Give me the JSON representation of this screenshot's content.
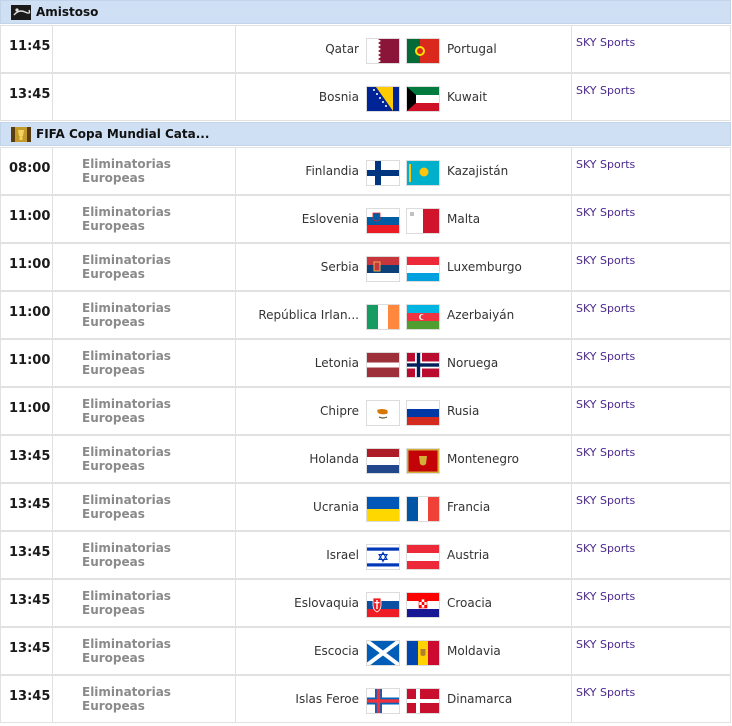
{
  "colors": {
    "group_header_bg": "#cfe0f4",
    "row_border": "#e1e1e1",
    "time_text": "#1a1a1a",
    "competition_text": "#8a8a8a",
    "channel_text": "#4b2a8c"
  },
  "groups": [
    {
      "title": "Amistoso",
      "icon": "friendly-match-icon",
      "matches": [
        {
          "time": "11:45",
          "competition": "",
          "home": "Qatar",
          "home_flag": "qatar-flag-icon",
          "away": "Portugal",
          "away_flag": "portugal-flag-icon",
          "channel": "SKY Sports"
        },
        {
          "time": "13:45",
          "competition": "",
          "home": "Bosnia",
          "home_flag": "bosnia-flag-icon",
          "away": "Kuwait",
          "away_flag": "kuwait-flag-icon",
          "channel": "SKY Sports"
        }
      ]
    },
    {
      "title": "FIFA Copa Mundial Cata...",
      "icon": "world-cup-icon",
      "matches": [
        {
          "time": "08:00",
          "competition": "Eliminatorias Europeas",
          "home": "Finlandia",
          "home_flag": "finland-flag-icon",
          "away": "Kazajistán",
          "away_flag": "kazakhstan-flag-icon",
          "channel": "SKY Sports"
        },
        {
          "time": "11:00",
          "competition": "Eliminatorias Europeas",
          "home": "Eslovenia",
          "home_flag": "slovenia-flag-icon",
          "away": "Malta",
          "away_flag": "malta-flag-icon",
          "channel": "SKY Sports"
        },
        {
          "time": "11:00",
          "competition": "Eliminatorias Europeas",
          "home": "Serbia",
          "home_flag": "serbia-flag-icon",
          "away": "Luxemburgo",
          "away_flag": "luxembourg-flag-icon",
          "channel": "SKY Sports"
        },
        {
          "time": "11:00",
          "competition": "Eliminatorias Europeas",
          "home": "República Irlan...",
          "home_flag": "ireland-flag-icon",
          "away": "Azerbaiyán",
          "away_flag": "azerbaijan-flag-icon",
          "channel": "SKY Sports"
        },
        {
          "time": "11:00",
          "competition": "Eliminatorias Europeas",
          "home": "Letonia",
          "home_flag": "latvia-flag-icon",
          "away": "Noruega",
          "away_flag": "norway-flag-icon",
          "channel": "SKY Sports"
        },
        {
          "time": "11:00",
          "competition": "Eliminatorias Europeas",
          "home": "Chipre",
          "home_flag": "cyprus-flag-icon",
          "away": "Rusia",
          "away_flag": "russia-flag-icon",
          "channel": "SKY Sports"
        },
        {
          "time": "13:45",
          "competition": "Eliminatorias Europeas",
          "home": "Holanda",
          "home_flag": "netherlands-flag-icon",
          "away": "Montenegro",
          "away_flag": "montenegro-flag-icon",
          "channel": "SKY Sports"
        },
        {
          "time": "13:45",
          "competition": "Eliminatorias Europeas",
          "home": "Ucrania",
          "home_flag": "ukraine-flag-icon",
          "away": "Francia",
          "away_flag": "france-flag-icon",
          "channel": "SKY Sports"
        },
        {
          "time": "13:45",
          "competition": "Eliminatorias Europeas",
          "home": "Israel",
          "home_flag": "israel-flag-icon",
          "away": "Austria",
          "away_flag": "austria-flag-icon",
          "channel": "SKY Sports"
        },
        {
          "time": "13:45",
          "competition": "Eliminatorias Europeas",
          "home": "Eslovaquia",
          "home_flag": "slovakia-flag-icon",
          "away": "Croacia",
          "away_flag": "croatia-flag-icon",
          "channel": "SKY Sports"
        },
        {
          "time": "13:45",
          "competition": "Eliminatorias Europeas",
          "home": "Escocia",
          "home_flag": "scotland-flag-icon",
          "away": "Moldavia",
          "away_flag": "moldova-flag-icon",
          "channel": "SKY Sports"
        },
        {
          "time": "13:45",
          "competition": "Eliminatorias Europeas",
          "home": "Islas Feroe",
          "home_flag": "faroe-islands-flag-icon",
          "away": "Dinamarca",
          "away_flag": "denmark-flag-icon",
          "channel": "SKY Sports"
        }
      ]
    }
  ]
}
